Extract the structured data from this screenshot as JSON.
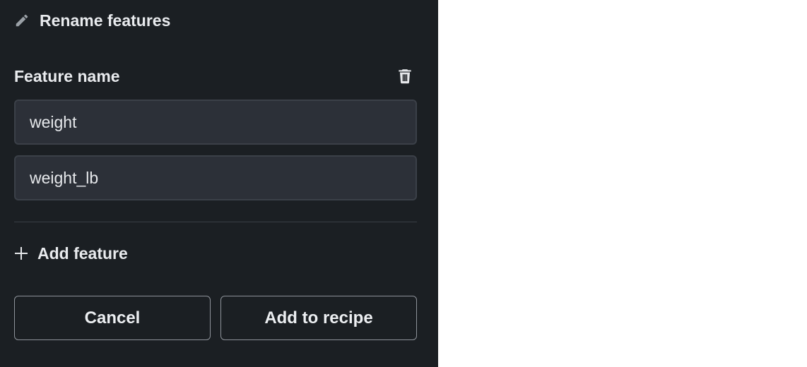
{
  "panel": {
    "title": "Rename features",
    "title_icon": "pencil-icon",
    "field_label": "Feature name",
    "delete_icon": "trash-icon",
    "inputs": [
      {
        "value": "weight"
      },
      {
        "value": "weight_lb"
      }
    ],
    "add_feature": {
      "icon": "plus-icon",
      "label": "Add feature"
    },
    "buttons": {
      "cancel_label": "Cancel",
      "submit_label": "Add to recipe"
    }
  },
  "colors": {
    "panel_bg": "#1b1f23",
    "input_bg": "#2c3038",
    "text": "#e9ebee",
    "button_border": "#8e939a"
  }
}
